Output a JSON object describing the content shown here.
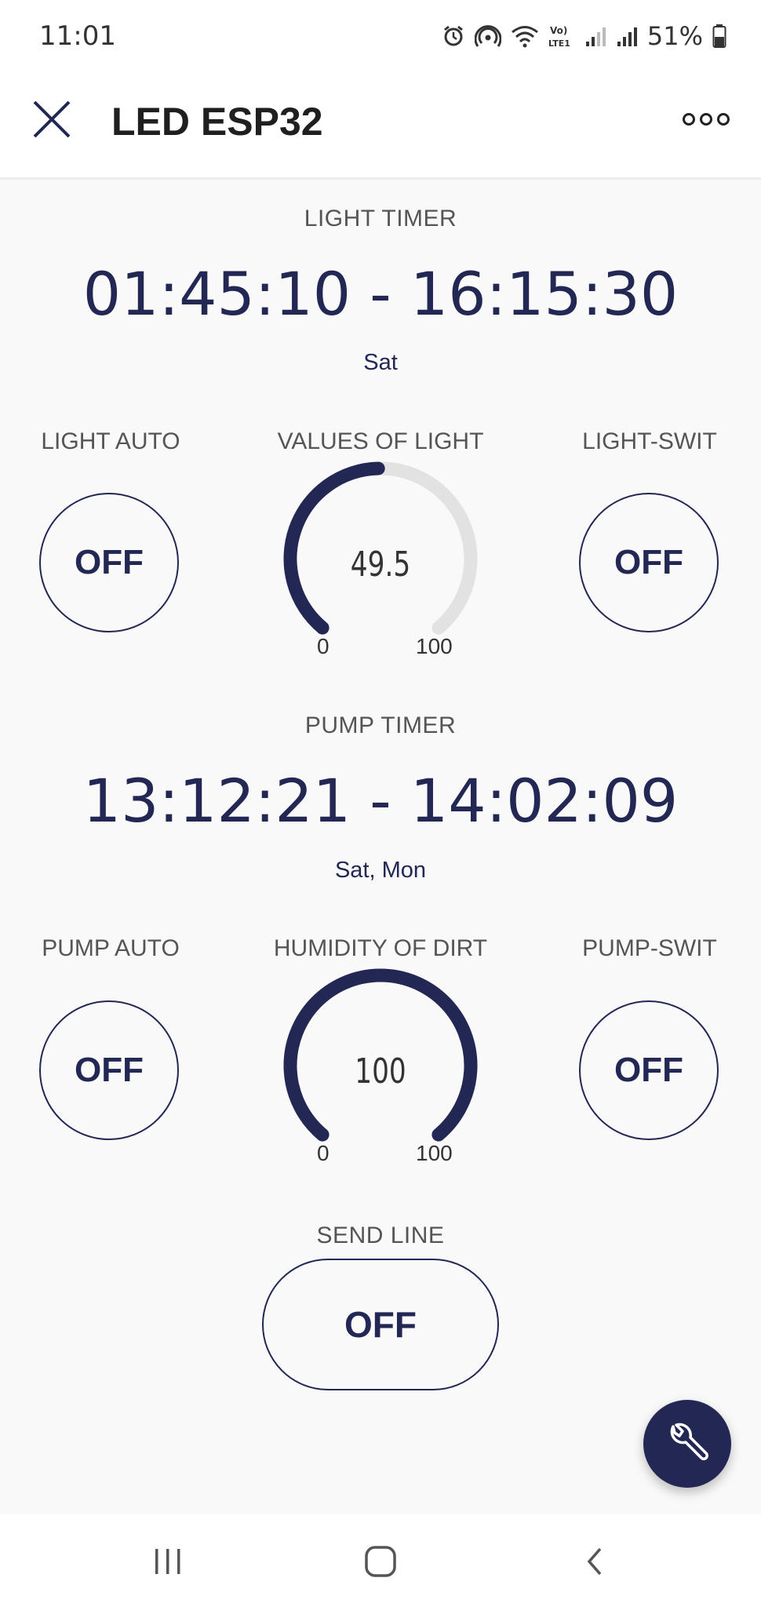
{
  "status_bar": {
    "time": "11:01",
    "battery": "51%",
    "icons": [
      "alarm-icon",
      "hotspot-icon",
      "wifi-icon",
      "volte-icon",
      "signal-icon",
      "signal-icon",
      "battery-icon"
    ]
  },
  "header": {
    "title": "LED ESP32",
    "close_icon": "close-icon",
    "more_icon": "more-icon"
  },
  "light": {
    "timer_label": "LIGHT TIMER",
    "timer_range": "01:45:10 - 16:15:30",
    "timer_days": "Sat",
    "auto_label": "LIGHT AUTO",
    "auto_state": "OFF",
    "gauge_label": "VALUES OF LIGHT",
    "gauge_value": "49.5",
    "gauge_min": "0",
    "gauge_max": "100",
    "gauge_level": 49.5,
    "switch_label": "LIGHT-SWIT",
    "switch_state": "OFF"
  },
  "pump": {
    "timer_label": "PUMP TIMER",
    "timer_range": "13:12:21 - 14:02:09",
    "timer_days": "Sat, Mon",
    "auto_label": "PUMP AUTO",
    "auto_state": "OFF",
    "gauge_label": "HUMIDITY OF DIRT",
    "gauge_value": "100",
    "gauge_min": "0",
    "gauge_max": "100",
    "gauge_level": 100,
    "switch_label": "PUMP-SWIT",
    "switch_state": "OFF"
  },
  "send_line": {
    "label": "SEND LINE",
    "state": "OFF"
  },
  "fab_icon": "wrench-icon",
  "nav": {
    "recent_icon": "recent-apps-icon",
    "home_icon": "home-icon",
    "back_icon": "back-icon"
  },
  "colors": {
    "accent": "#222753",
    "track": "#e2e2e2",
    "background": "#f9f9f9"
  }
}
